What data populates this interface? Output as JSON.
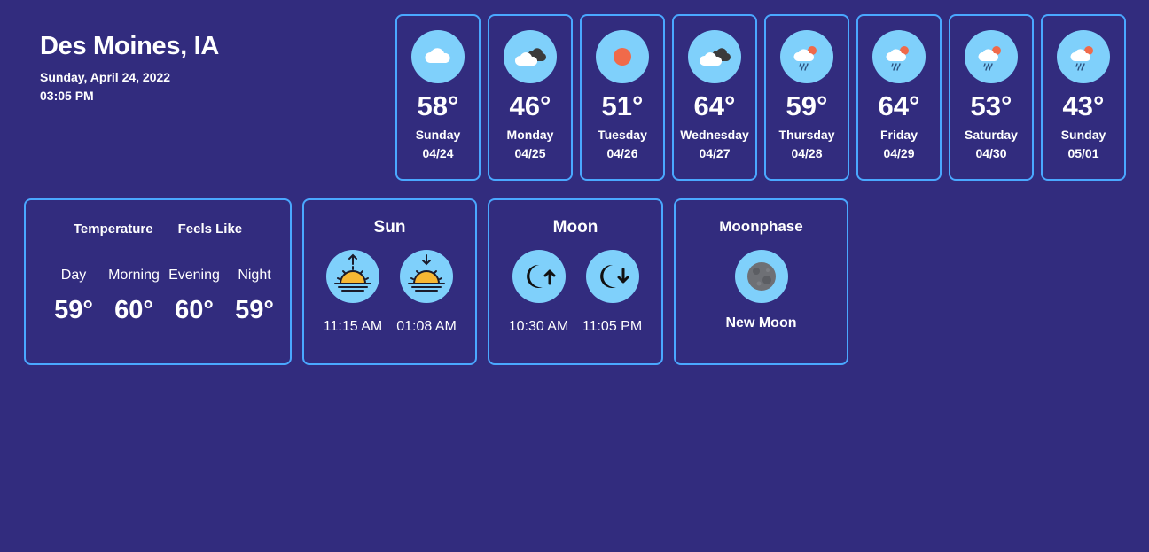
{
  "location": {
    "city": "Des Moines, IA",
    "date": "Sunday, April 24, 2022",
    "time": "03:05 PM"
  },
  "forecast": [
    {
      "temp": "58°",
      "day": "Sunday",
      "date": "04/24",
      "icon": "cloud-icon"
    },
    {
      "temp": "46°",
      "day": "Monday",
      "date": "04/25",
      "icon": "broken-clouds-icon"
    },
    {
      "temp": "51°",
      "day": "Tuesday",
      "date": "04/26",
      "icon": "sun-icon"
    },
    {
      "temp": "64°",
      "day": "Wednesday",
      "date": "04/27",
      "icon": "broken-clouds-icon"
    },
    {
      "temp": "59°",
      "day": "Thursday",
      "date": "04/28",
      "icon": "rain-cloud-sun-icon"
    },
    {
      "temp": "64°",
      "day": "Friday",
      "date": "04/29",
      "icon": "rain-cloud-sun-icon"
    },
    {
      "temp": "53°",
      "day": "Saturday",
      "date": "04/30",
      "icon": "rain-cloud-sun-icon"
    },
    {
      "temp": "43°",
      "day": "Sunday",
      "date": "05/01",
      "icon": "rain-cloud-sun-icon"
    }
  ],
  "temperature_panel": {
    "tab_temperature": "Temperature",
    "tab_feels_like": "Feels Like",
    "periods": [
      {
        "label": "Day",
        "temp": "59°"
      },
      {
        "label": "Morning",
        "temp": "60°"
      },
      {
        "label": "Evening",
        "temp": "60°"
      },
      {
        "label": "Night",
        "temp": "59°"
      }
    ]
  },
  "sun_panel": {
    "title": "Sun",
    "sunrise": "11:15 AM",
    "sunset": "01:08 AM",
    "sunrise_icon": "sunrise-icon",
    "sunset_icon": "sunset-icon"
  },
  "moon_panel": {
    "title": "Moon",
    "moonrise": "10:30 AM",
    "moonset": "11:05 PM",
    "moonrise_icon": "moonrise-icon",
    "moonset_icon": "moonset-icon"
  },
  "moonphase_panel": {
    "title": "Moonphase",
    "phase": "New Moon",
    "icon": "new-moon-icon"
  },
  "colors": {
    "background": "#322c7e",
    "card_border": "#4aa8ff",
    "icon_circle": "#7fd0fb",
    "text": "#ffffff"
  }
}
